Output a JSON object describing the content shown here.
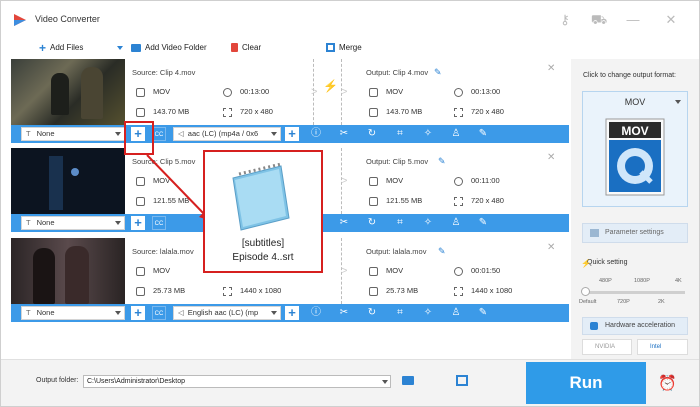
{
  "window": {
    "title": "Video Converter"
  },
  "toolbar": {
    "add_files": "Add Files",
    "add_video_folder": "Add Video Folder",
    "clear": "Clear",
    "merge": "Merge"
  },
  "items": [
    {
      "source_title": "Source: Clip 4.mov",
      "output_title": "Output: Clip 4.mov",
      "src_format": "MOV",
      "src_duration": "00:13:00",
      "src_size": "143.70 MB",
      "src_resolution": "720 x 480",
      "out_format": "MOV",
      "out_duration": "00:13:00",
      "out_size": "143.70 MB",
      "out_resolution": "720 x 480",
      "subtitle": "None",
      "audio": "aac (LC) (mp4a / 0x6"
    },
    {
      "source_title": "Source: Clip 5.mov",
      "output_title": "Output: Clip 5.mov",
      "src_format": "MOV",
      "src_duration": "00:11:00",
      "src_size": "121.55 MB",
      "src_resolution": "720 x 480",
      "out_format": "MOV",
      "out_duration": "00:11:00",
      "out_size": "121.55 MB",
      "out_resolution": "720 x 480",
      "subtitle": "None",
      "audio": ""
    },
    {
      "source_title": "Source: lalala.mov",
      "output_title": "Output: lalala.mov",
      "src_format": "MOV",
      "src_duration": "00:01:50",
      "src_size": "25.73 MB",
      "src_resolution": "1440 x 1080",
      "out_format": "MOV",
      "out_duration": "00:01:50",
      "out_size": "25.73 MB",
      "out_resolution": "1440 x 1080",
      "subtitle": "None",
      "audio": "English aac (LC) (mp"
    }
  ],
  "popup": {
    "line1": "[subtitles]",
    "line2": "Episode 4..srt"
  },
  "right_panel": {
    "hint": "Click to change output format:",
    "format": "MOV",
    "parameter_settings": "Parameter settings",
    "quick_setting": "Quick setting",
    "ticks_top": [
      "480P",
      "1080P",
      "4K"
    ],
    "ticks_bottom": [
      "Default",
      "720P",
      "2K"
    ],
    "hardware_acceleration": "Hardware acceleration",
    "nvidia": "NVIDIA",
    "intel": "Intel"
  },
  "bottom": {
    "output_folder_label": "Output folder:",
    "output_folder_path": "C:\\Users\\Administrator\\Desktop",
    "run": "Run"
  },
  "colors": {
    "accent": "#3c9ae8",
    "run": "#2f9be8",
    "highlight": "#d6201f",
    "bolt": "#f0951a"
  }
}
